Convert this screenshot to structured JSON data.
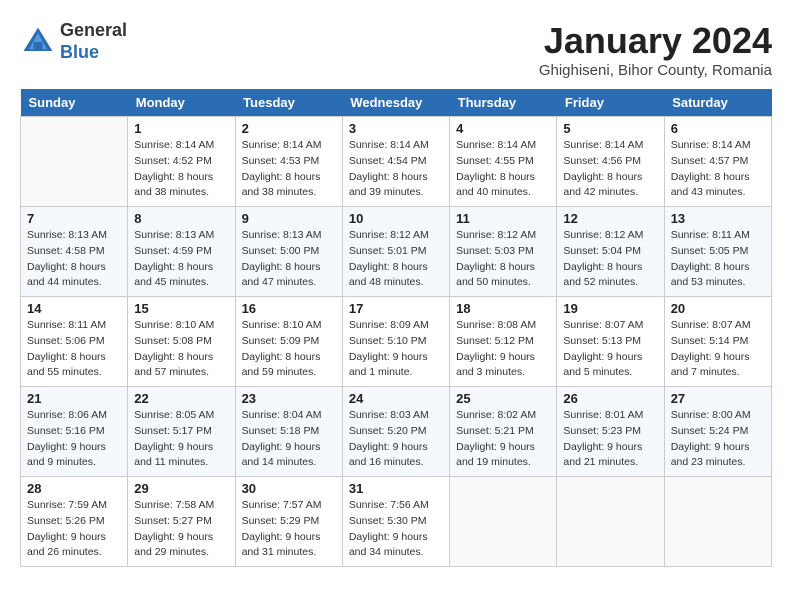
{
  "header": {
    "logo_general": "General",
    "logo_blue": "Blue",
    "month_title": "January 2024",
    "location": "Ghighiseni, Bihor County, Romania"
  },
  "days_of_week": [
    "Sunday",
    "Monday",
    "Tuesday",
    "Wednesday",
    "Thursday",
    "Friday",
    "Saturday"
  ],
  "weeks": [
    [
      {
        "day": "",
        "info": ""
      },
      {
        "day": "1",
        "info": "Sunrise: 8:14 AM\nSunset: 4:52 PM\nDaylight: 8 hours\nand 38 minutes."
      },
      {
        "day": "2",
        "info": "Sunrise: 8:14 AM\nSunset: 4:53 PM\nDaylight: 8 hours\nand 38 minutes."
      },
      {
        "day": "3",
        "info": "Sunrise: 8:14 AM\nSunset: 4:54 PM\nDaylight: 8 hours\nand 39 minutes."
      },
      {
        "day": "4",
        "info": "Sunrise: 8:14 AM\nSunset: 4:55 PM\nDaylight: 8 hours\nand 40 minutes."
      },
      {
        "day": "5",
        "info": "Sunrise: 8:14 AM\nSunset: 4:56 PM\nDaylight: 8 hours\nand 42 minutes."
      },
      {
        "day": "6",
        "info": "Sunrise: 8:14 AM\nSunset: 4:57 PM\nDaylight: 8 hours\nand 43 minutes."
      }
    ],
    [
      {
        "day": "7",
        "info": "Sunrise: 8:13 AM\nSunset: 4:58 PM\nDaylight: 8 hours\nand 44 minutes."
      },
      {
        "day": "8",
        "info": "Sunrise: 8:13 AM\nSunset: 4:59 PM\nDaylight: 8 hours\nand 45 minutes."
      },
      {
        "day": "9",
        "info": "Sunrise: 8:13 AM\nSunset: 5:00 PM\nDaylight: 8 hours\nand 47 minutes."
      },
      {
        "day": "10",
        "info": "Sunrise: 8:12 AM\nSunset: 5:01 PM\nDaylight: 8 hours\nand 48 minutes."
      },
      {
        "day": "11",
        "info": "Sunrise: 8:12 AM\nSunset: 5:03 PM\nDaylight: 8 hours\nand 50 minutes."
      },
      {
        "day": "12",
        "info": "Sunrise: 8:12 AM\nSunset: 5:04 PM\nDaylight: 8 hours\nand 52 minutes."
      },
      {
        "day": "13",
        "info": "Sunrise: 8:11 AM\nSunset: 5:05 PM\nDaylight: 8 hours\nand 53 minutes."
      }
    ],
    [
      {
        "day": "14",
        "info": "Sunrise: 8:11 AM\nSunset: 5:06 PM\nDaylight: 8 hours\nand 55 minutes."
      },
      {
        "day": "15",
        "info": "Sunrise: 8:10 AM\nSunset: 5:08 PM\nDaylight: 8 hours\nand 57 minutes."
      },
      {
        "day": "16",
        "info": "Sunrise: 8:10 AM\nSunset: 5:09 PM\nDaylight: 8 hours\nand 59 minutes."
      },
      {
        "day": "17",
        "info": "Sunrise: 8:09 AM\nSunset: 5:10 PM\nDaylight: 9 hours\nand 1 minute."
      },
      {
        "day": "18",
        "info": "Sunrise: 8:08 AM\nSunset: 5:12 PM\nDaylight: 9 hours\nand 3 minutes."
      },
      {
        "day": "19",
        "info": "Sunrise: 8:07 AM\nSunset: 5:13 PM\nDaylight: 9 hours\nand 5 minutes."
      },
      {
        "day": "20",
        "info": "Sunrise: 8:07 AM\nSunset: 5:14 PM\nDaylight: 9 hours\nand 7 minutes."
      }
    ],
    [
      {
        "day": "21",
        "info": "Sunrise: 8:06 AM\nSunset: 5:16 PM\nDaylight: 9 hours\nand 9 minutes."
      },
      {
        "day": "22",
        "info": "Sunrise: 8:05 AM\nSunset: 5:17 PM\nDaylight: 9 hours\nand 11 minutes."
      },
      {
        "day": "23",
        "info": "Sunrise: 8:04 AM\nSunset: 5:18 PM\nDaylight: 9 hours\nand 14 minutes."
      },
      {
        "day": "24",
        "info": "Sunrise: 8:03 AM\nSunset: 5:20 PM\nDaylight: 9 hours\nand 16 minutes."
      },
      {
        "day": "25",
        "info": "Sunrise: 8:02 AM\nSunset: 5:21 PM\nDaylight: 9 hours\nand 19 minutes."
      },
      {
        "day": "26",
        "info": "Sunrise: 8:01 AM\nSunset: 5:23 PM\nDaylight: 9 hours\nand 21 minutes."
      },
      {
        "day": "27",
        "info": "Sunrise: 8:00 AM\nSunset: 5:24 PM\nDaylight: 9 hours\nand 23 minutes."
      }
    ],
    [
      {
        "day": "28",
        "info": "Sunrise: 7:59 AM\nSunset: 5:26 PM\nDaylight: 9 hours\nand 26 minutes."
      },
      {
        "day": "29",
        "info": "Sunrise: 7:58 AM\nSunset: 5:27 PM\nDaylight: 9 hours\nand 29 minutes."
      },
      {
        "day": "30",
        "info": "Sunrise: 7:57 AM\nSunset: 5:29 PM\nDaylight: 9 hours\nand 31 minutes."
      },
      {
        "day": "31",
        "info": "Sunrise: 7:56 AM\nSunset: 5:30 PM\nDaylight: 9 hours\nand 34 minutes."
      },
      {
        "day": "",
        "info": ""
      },
      {
        "day": "",
        "info": ""
      },
      {
        "day": "",
        "info": ""
      }
    ]
  ]
}
